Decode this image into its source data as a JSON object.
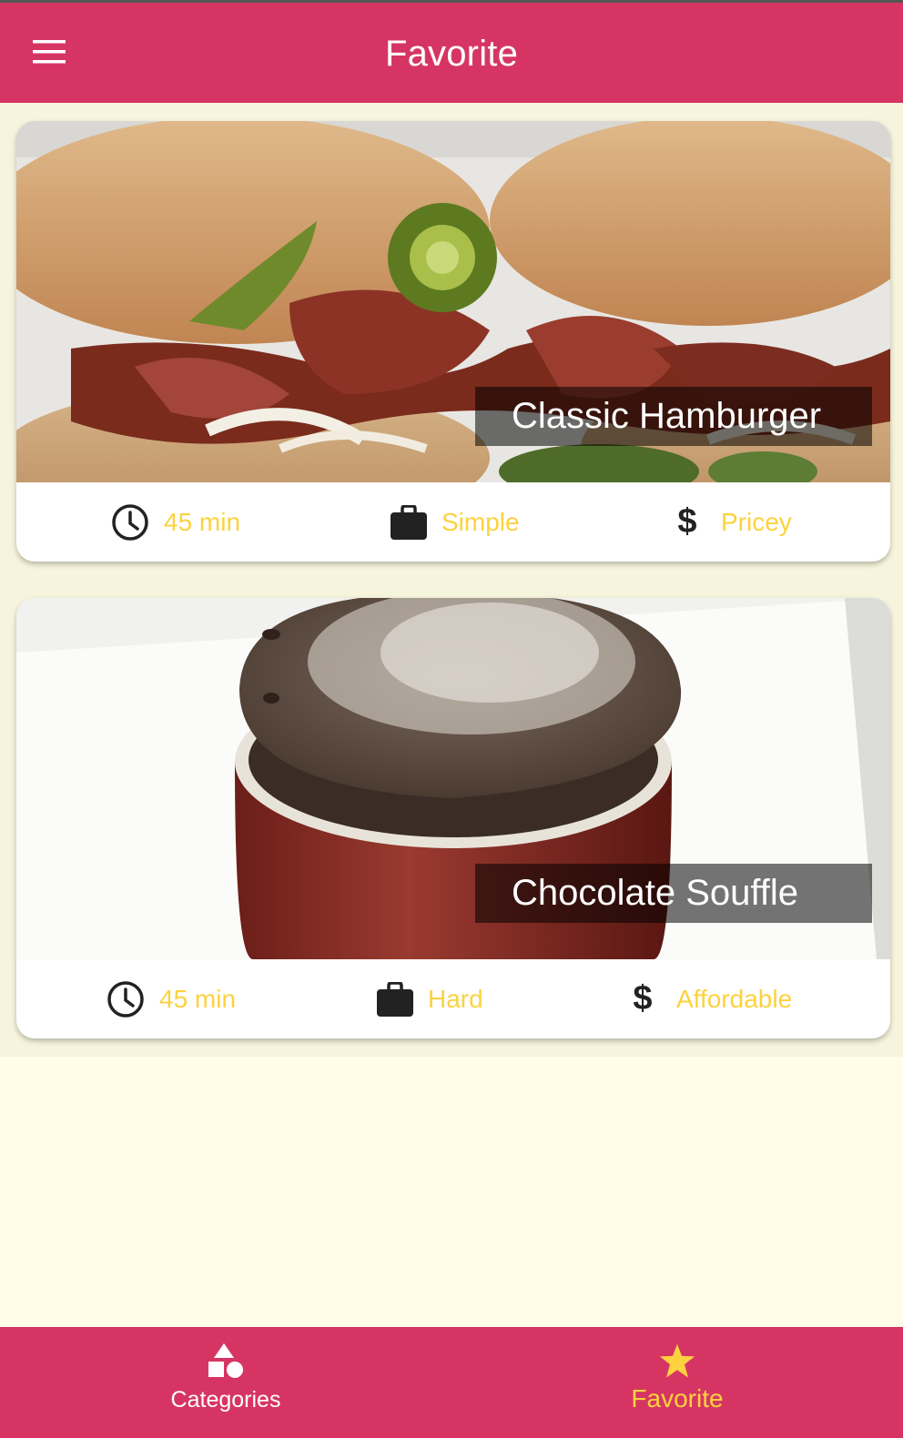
{
  "app_bar": {
    "title": "Favorite",
    "menu_icon": "menu-icon"
  },
  "meals": [
    {
      "title": "Classic Hamburger",
      "duration": "45 min",
      "complexity": "Simple",
      "affordability": "Pricey",
      "image": "hamburger photo"
    },
    {
      "title": "Chocolate Souffle",
      "duration": "45 min",
      "complexity": "Hard",
      "affordability": "Affordable",
      "image": "chocolate souffle photo"
    }
  ],
  "bottom_nav": {
    "items": [
      {
        "label": "Categories",
        "icon": "shapes-icon",
        "selected": false
      },
      {
        "label": "Favorite",
        "icon": "star-icon",
        "selected": true
      }
    ]
  },
  "colors": {
    "primary": "#d63564",
    "accent": "#fcd23e",
    "background": "#fffde7",
    "card": "#ffffff",
    "title_overlay": "rgba(0,0,0,0.54)"
  }
}
